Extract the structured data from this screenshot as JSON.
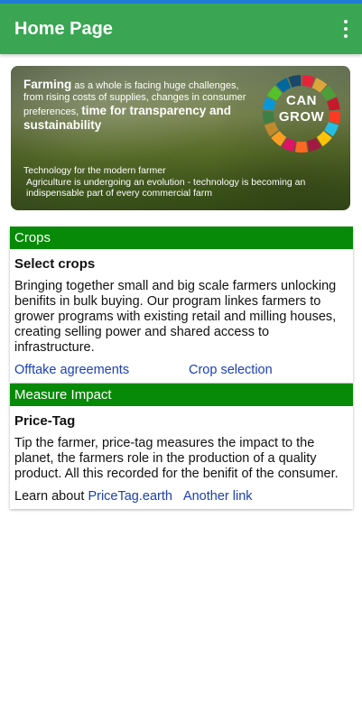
{
  "appbar": {
    "title": "Home Page",
    "menu_icon": "more-vertical-icon"
  },
  "banner": {
    "headline_bold_1": "Farming",
    "headline_text_1": " as a whole is facing huge challenges, from rising costs of supplies, changes in consumer preferences, ",
    "headline_bold_2": "time for transparency and sustainability",
    "subtitle_1": "Technology for the modern farmer",
    "subtitle_2": "Agriculture is undergoing an evolution - technology is becoming an indispensable part of every commercial farm",
    "logo_line_1": "CAN",
    "logo_line_2": "GROW",
    "logo_colors": [
      "#e5243b",
      "#dda63a",
      "#4c9f38",
      "#c5192d",
      "#ff3a21",
      "#26bde2",
      "#fcc30b",
      "#a21942",
      "#fd6925",
      "#dd1367",
      "#fd9d24",
      "#bf8b2e",
      "#3f7e44",
      "#0a97d9",
      "#56c02b",
      "#00689d",
      "#19486a"
    ]
  },
  "crops_card": {
    "header": "Crops",
    "title": "Select crops",
    "text": "Bringing together small and big scale farmers unlocking benifits in bulk buying. Our program linkes farmers to grower programs with existing retail and milling houses, creating selling power and shared access to infrastructure.",
    "link_1": "Offtake agreements",
    "link_2": "Crop selection"
  },
  "impact_card": {
    "header": "Measure Impact",
    "title": "Price-Tag",
    "text": "Tip the farmer, price-tag measures the impact to the planet, the farmers role in the production of a quality product. All this recorded for the benifit of the consumer.",
    "learn_prefix": "Learn about ",
    "link_1": "PriceTag.earth",
    "link_2": "Another link"
  },
  "colors": {
    "appbar": "#3aa653",
    "card_header": "#078a07",
    "link": "#1a3fb3",
    "status_bar": "#1f7bd6"
  }
}
